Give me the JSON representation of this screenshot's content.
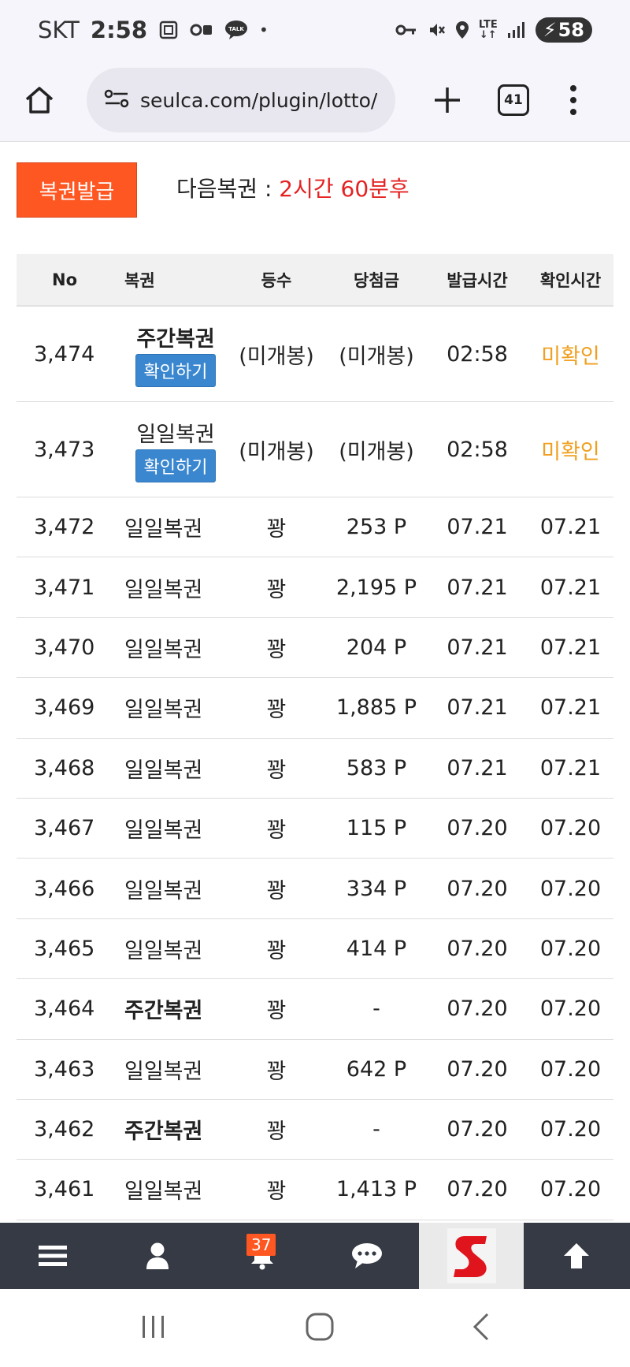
{
  "status_bar": {
    "carrier": "SKT",
    "time": "2:58",
    "talk_label": "TALK",
    "network": "LTE",
    "battery": "58"
  },
  "browser": {
    "url": "seulca.com/plugin/lotto/",
    "tab_count": "41"
  },
  "page": {
    "issue_button": "복권발급",
    "next_label": "다음복권 : ",
    "next_value": "2시간 60분후"
  },
  "table": {
    "headers": [
      "No",
      "복권",
      "등수",
      "당첨금",
      "발급시간",
      "확인시간"
    ],
    "confirm_label": "확인하기",
    "rows": [
      {
        "no": "3,474",
        "type": "주간복권",
        "rank": "(미개봉)",
        "prize": "(미개봉)",
        "issued": "02:58",
        "checked": "미확인"
      },
      {
        "no": "3,473",
        "type": "일일복권",
        "rank": "(미개봉)",
        "prize": "(미개봉)",
        "issued": "02:58",
        "checked": "미확인"
      },
      {
        "no": "3,472",
        "type": "일일복권",
        "rank": "꽝",
        "prize": "253 P",
        "issued": "07.21",
        "checked": "07.21"
      },
      {
        "no": "3,471",
        "type": "일일복권",
        "rank": "꽝",
        "prize": "2,195 P",
        "issued": "07.21",
        "checked": "07.21"
      },
      {
        "no": "3,470",
        "type": "일일복권",
        "rank": "꽝",
        "prize": "204 P",
        "issued": "07.21",
        "checked": "07.21"
      },
      {
        "no": "3,469",
        "type": "일일복권",
        "rank": "꽝",
        "prize": "1,885 P",
        "issued": "07.21",
        "checked": "07.21"
      },
      {
        "no": "3,468",
        "type": "일일복권",
        "rank": "꽝",
        "prize": "583 P",
        "issued": "07.21",
        "checked": "07.21"
      },
      {
        "no": "3,467",
        "type": "일일복권",
        "rank": "꽝",
        "prize": "115 P",
        "issued": "07.20",
        "checked": "07.20"
      },
      {
        "no": "3,466",
        "type": "일일복권",
        "rank": "꽝",
        "prize": "334 P",
        "issued": "07.20",
        "checked": "07.20"
      },
      {
        "no": "3,465",
        "type": "일일복권",
        "rank": "꽝",
        "prize": "414 P",
        "issued": "07.20",
        "checked": "07.20"
      },
      {
        "no": "3,464",
        "type": "주간복권",
        "rank": "꽝",
        "prize": "-",
        "issued": "07.20",
        "checked": "07.20"
      },
      {
        "no": "3,463",
        "type": "일일복권",
        "rank": "꽝",
        "prize": "642 P",
        "issued": "07.20",
        "checked": "07.20"
      },
      {
        "no": "3,462",
        "type": "주간복권",
        "rank": "꽝",
        "prize": "-",
        "issued": "07.20",
        "checked": "07.20"
      },
      {
        "no": "3,461",
        "type": "일일복권",
        "rank": "꽝",
        "prize": "1,413 P",
        "issued": "07.20",
        "checked": "07.20"
      }
    ]
  },
  "app_nav": {
    "notification_count": "37",
    "items": [
      "menu-icon",
      "user-icon",
      "bell-icon",
      "chat-icon",
      "site-logo",
      "arrow-up-icon"
    ]
  },
  "colors": {
    "accent_orange": "#fe5722",
    "countdown_red": "#e52222",
    "unchecked_orange": "#f0a020",
    "confirm_blue": "#3a87d0",
    "nav_dark": "#353a44"
  }
}
